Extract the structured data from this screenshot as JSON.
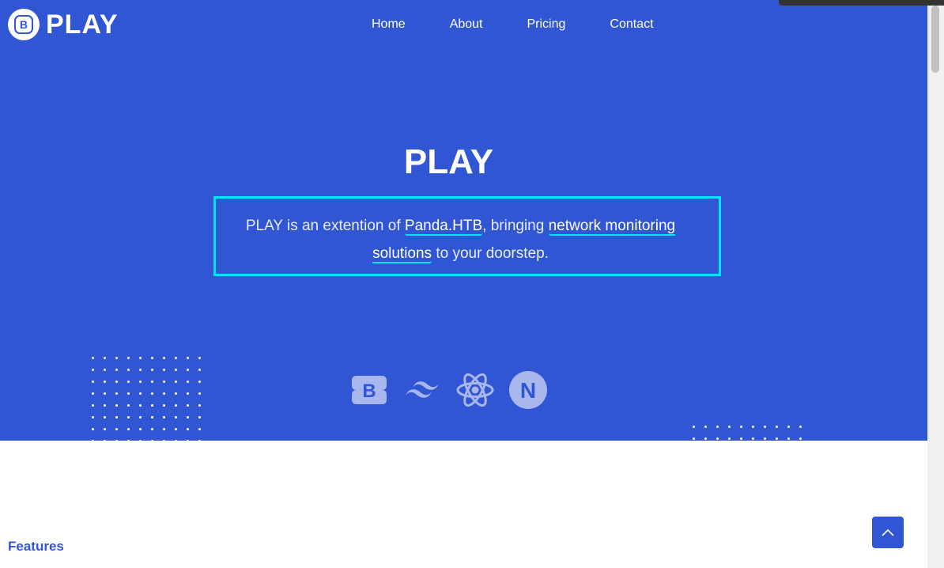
{
  "logo": {
    "badge_letter": "B",
    "text": "PLAY"
  },
  "nav": {
    "items": [
      "Home",
      "About",
      "Pricing",
      "Contact"
    ]
  },
  "hero": {
    "title": "PLAY",
    "description": {
      "part1": "PLAY is an extention of ",
      "highlight1": "Panda.HTB",
      "part2": ", bringing ",
      "highlight2": "network monitoring solutions",
      "part3": " to your doorstep."
    }
  },
  "brands": [
    {
      "icon": "bootstrap-icon",
      "letter": "B"
    },
    {
      "icon": "tailwind-icon"
    },
    {
      "icon": "react-icon"
    },
    {
      "icon": "nextjs-icon",
      "letter": "N"
    }
  ],
  "features": {
    "title": "Features"
  },
  "colors": {
    "primary": "#3056d3",
    "accent": "#00e5ff",
    "white": "#ffffff"
  }
}
